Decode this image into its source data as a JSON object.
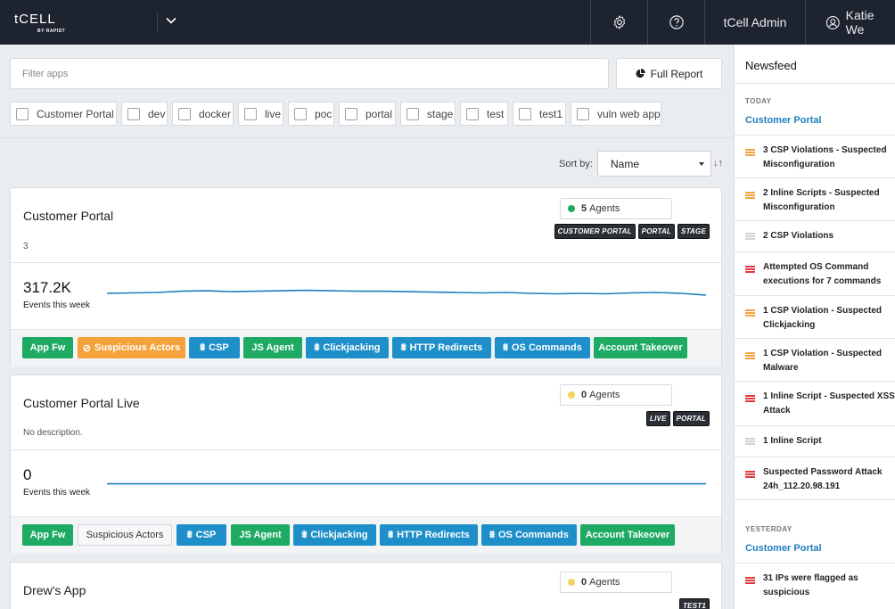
{
  "colors": {
    "topbar": "#1d2430",
    "accent_blue": "#1e8fc8",
    "accent_green": "#1eaa63",
    "accent_orange": "#f6a23a",
    "link": "#1e7fc0",
    "sev_high": "#e0393e",
    "sev_medium": "#f5a243",
    "sev_low": "#cfd3d8"
  },
  "topbar": {
    "logo": "tCELL",
    "logo_sub": "BY RAPID7",
    "app_dropdown_icon": "chevron-down-icon",
    "settings_icon": "gear-icon",
    "help_icon": "help-circle-icon",
    "account_label": "tCell Admin",
    "user_icon": "user-circle-icon",
    "user_name": "Katie We"
  },
  "filter": {
    "placeholder": "Filter apps",
    "full_report_label": "Full Report",
    "full_report_icon": "pie-chart-icon",
    "chips": [
      "Customer Portal",
      "dev",
      "docker",
      "live",
      "poc",
      "portal",
      "stage",
      "test",
      "test1",
      "vuln web app"
    ]
  },
  "sort": {
    "label": "Sort by:",
    "selected": "Name",
    "order_icon": "↓↑"
  },
  "apps": [
    {
      "name": "Customer Portal",
      "description": "3",
      "agents_count": "5",
      "agents_label": "Agents",
      "agents_status_color": "#1eaa63",
      "tags": [
        "CUSTOMER PORTAL",
        "PORTAL",
        "STAGE"
      ],
      "events": "317.2K",
      "events_label": "Events this week",
      "sparkline": [
        0.5,
        0.48,
        0.46,
        0.4,
        0.38,
        0.42,
        0.4,
        0.38,
        0.36,
        0.38,
        0.4,
        0.4,
        0.42,
        0.44,
        0.46,
        0.48,
        0.46,
        0.5,
        0.52,
        0.5,
        0.52,
        0.48,
        0.46,
        0.5,
        0.58
      ],
      "features": [
        {
          "label": "App Fw",
          "style": "green",
          "icon": ""
        },
        {
          "label": "Suspicious Actors",
          "style": "orange",
          "icon": "⊘"
        },
        {
          "label": "CSP",
          "style": "blue",
          "icon": "⩩"
        },
        {
          "label": "JS Agent",
          "style": "green",
          "icon": ""
        },
        {
          "label": "Clickjacking",
          "style": "blue",
          "icon": "⩩"
        },
        {
          "label": "HTTP Redirects",
          "style": "blue",
          "icon": "⩩"
        },
        {
          "label": "OS Commands",
          "style": "blue",
          "icon": "⩩"
        },
        {
          "label": "Account Takeover",
          "style": "green",
          "icon": ""
        }
      ]
    },
    {
      "name": "Customer Portal Live",
      "description": "No description.",
      "agents_count": "0",
      "agents_label": "Agents",
      "agents_status_color": "#f2d35b",
      "tags": [
        "LIVE",
        "PORTAL"
      ],
      "events": "0",
      "events_label": "Events this week",
      "sparkline": [
        0.65,
        0.65
      ],
      "features": [
        {
          "label": "App Fw",
          "style": "green",
          "icon": ""
        },
        {
          "label": "Suspicious Actors",
          "style": "plain",
          "icon": ""
        },
        {
          "label": "CSP",
          "style": "blue",
          "icon": "⩩"
        },
        {
          "label": "JS Agent",
          "style": "green",
          "icon": ""
        },
        {
          "label": "Clickjacking",
          "style": "blue",
          "icon": "⩩"
        },
        {
          "label": "HTTP Redirects",
          "style": "blue",
          "icon": "⩩"
        },
        {
          "label": "OS Commands",
          "style": "blue",
          "icon": "⩩"
        },
        {
          "label": "Account Takeover",
          "style": "green",
          "icon": ""
        }
      ]
    },
    {
      "name": "Drew's App",
      "agents_count": "0",
      "agents_label": "Agents",
      "agents_status_color": "#f2d35b",
      "tags": [
        "TEST1"
      ]
    }
  ],
  "newsfeed": {
    "title": "Newsfeed",
    "groups": [
      {
        "day": "TODAY",
        "app": "Customer Portal",
        "items": [
          {
            "severity": "medium",
            "text": "3 CSP Violations - Suspected\nMisconfiguration"
          },
          {
            "severity": "medium",
            "text": "2 Inline Scripts - Suspected\nMisconfiguration"
          },
          {
            "severity": "low",
            "text": "2 CSP Violations"
          },
          {
            "severity": "high",
            "text": "Attempted OS Command\nexecutions for 7 commands"
          },
          {
            "severity": "medium",
            "text": "1 CSP Violation - Suspected\nClickjacking"
          },
          {
            "severity": "medium",
            "text": "1 CSP Violation - Suspected\nMalware"
          },
          {
            "severity": "high",
            "text": "1 Inline Script - Suspected XSS\nAttack"
          },
          {
            "severity": "low",
            "text": "1 Inline Script"
          },
          {
            "severity": "high",
            "text": "Suspected Password Attack\n24h_112.20.98.191"
          }
        ]
      },
      {
        "day": "YESTERDAY",
        "app": "Customer Portal",
        "items": [
          {
            "severity": "high",
            "text": "31 IPs were flagged as\nsuspicious"
          }
        ]
      }
    ]
  }
}
